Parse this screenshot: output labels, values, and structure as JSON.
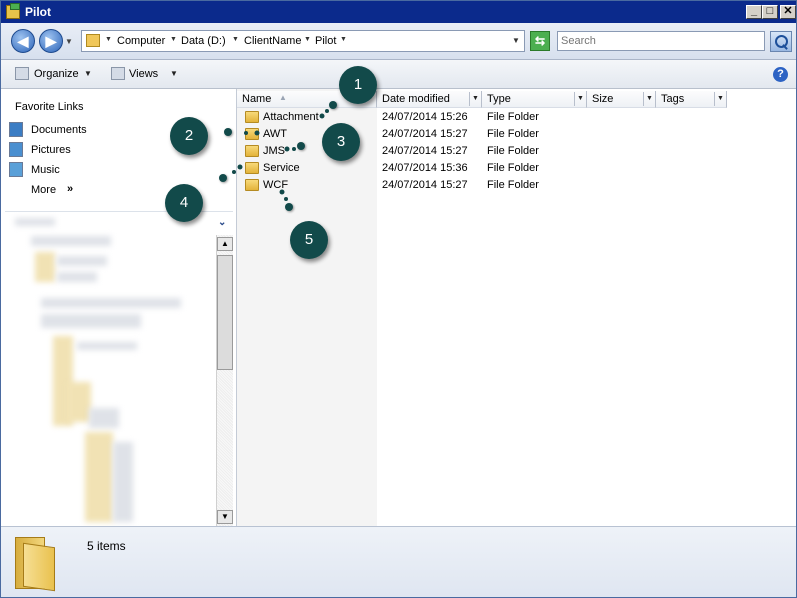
{
  "window": {
    "title": "Pilot",
    "controls": {
      "minimize": "_",
      "maximize": "□",
      "close": "✕"
    }
  },
  "nav": {
    "back_icon": "back-arrow-icon",
    "forward_icon": "forward-arrow-icon",
    "back_glyph": "◀",
    "forward_glyph": "▶",
    "dropdown_glyph": "▼"
  },
  "address": {
    "crumbs": [
      "Computer",
      "Data (D:)",
      "ClientName",
      "Pilot"
    ],
    "separator_glyph": "▼"
  },
  "search": {
    "placeholder": "Search",
    "refresh_glyph": "⇆"
  },
  "toolbar": {
    "organize_label": "Organize",
    "views_label": "Views",
    "dropdown_glyph": "▼",
    "help_glyph": "?"
  },
  "sidebar": {
    "favorites_title": "Favorite Links",
    "items": [
      {
        "label": "Documents",
        "icon": "documents-icon",
        "color": "#3b7dc4"
      },
      {
        "label": "Pictures",
        "icon": "pictures-icon",
        "color": "#4a8fd0"
      },
      {
        "label": "Music",
        "icon": "music-icon",
        "color": "#5aa0d8"
      }
    ],
    "more_label": "More",
    "more_glyph": "»",
    "folders_chevron": "⌄"
  },
  "columns": [
    {
      "label": "Name"
    },
    {
      "label": "Date modified"
    },
    {
      "label": "Type"
    },
    {
      "label": "Size"
    },
    {
      "label": "Tags"
    }
  ],
  "sort_glyph": "▲",
  "files": [
    {
      "name": "Attachment",
      "date": "24/07/2014 15:26",
      "type": "File Folder"
    },
    {
      "name": "AWT",
      "date": "24/07/2014 15:27",
      "type": "File Folder"
    },
    {
      "name": "JMS",
      "date": "24/07/2014 15:27",
      "type": "File Folder"
    },
    {
      "name": "Service",
      "date": "24/07/2014 15:36",
      "type": "File Folder"
    },
    {
      "name": "WCF",
      "date": "24/07/2014 15:27",
      "type": "File Folder"
    }
  ],
  "callouts": [
    "1",
    "2",
    "3",
    "4",
    "5"
  ],
  "details": {
    "count_text": "5 items"
  },
  "colors": {
    "titlebar": "#0b2a8c",
    "callout": "#124a4a",
    "folder": "#f0c75a"
  }
}
